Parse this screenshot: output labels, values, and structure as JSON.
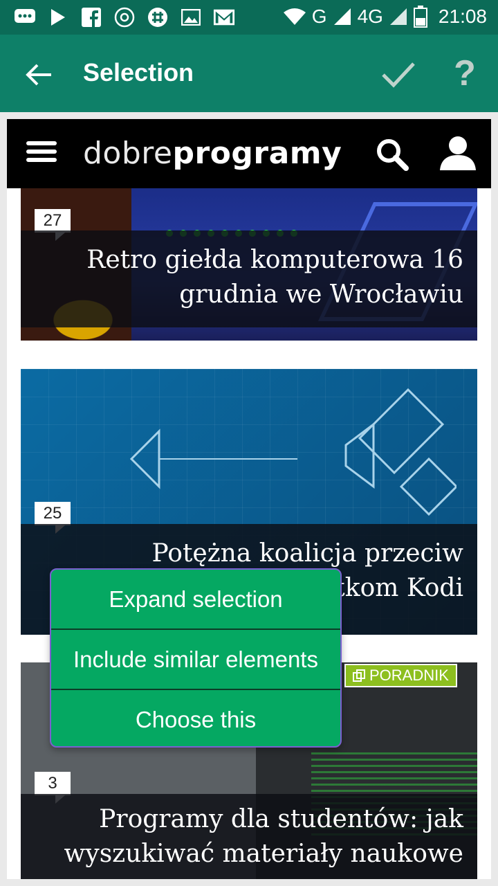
{
  "status_bar": {
    "network": "G",
    "network2": "4G",
    "time": "21:08"
  },
  "app_bar": {
    "title": "Selection"
  },
  "site": {
    "logo_light": "dobre",
    "logo_bold": "programy"
  },
  "articles": [
    {
      "count": "27",
      "title": "Retro giełda komputerowa 16 grudnia we Wrocławiu"
    },
    {
      "count": "25",
      "title": "Potężna koalicja przeciw twórcom dodatkom Kodi"
    },
    {
      "count": "3",
      "tag": "PORADNIK",
      "title": "Programy dla studentów: jak wyszukiwać materiały naukowe"
    }
  ],
  "context_menu": {
    "items": [
      "Expand selection",
      "Include similar elements",
      "Choose this"
    ]
  },
  "colors": {
    "status_bar": "#0b6b57",
    "app_bar": "#0e8068",
    "menu_green": "#05a862",
    "tag_green": "#8dbf1f"
  }
}
